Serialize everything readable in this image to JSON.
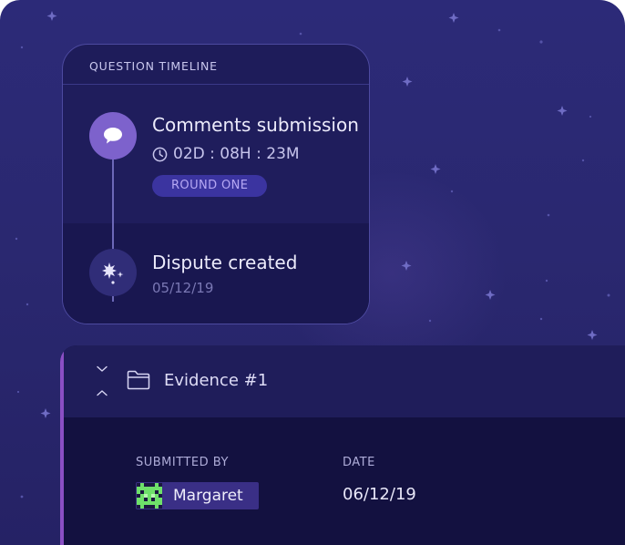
{
  "timeline": {
    "header": "QUESTION TIMELINE",
    "events": [
      {
        "title": "Comments submission",
        "icon": "speech-bubble-icon",
        "countdown": {
          "days": "02",
          "days_unit": "D",
          "hours": "08",
          "hours_unit": "H",
          "minutes": "23",
          "minutes_unit": "M",
          "separator": ":"
        },
        "badge": "ROUND ONE"
      },
      {
        "title": "Dispute created",
        "icon": "sparkle-icon",
        "date": "05/12/19"
      }
    ]
  },
  "evidence": {
    "title": "Evidence #1",
    "submitted_by_label": "SUBMITTED BY",
    "submitted_by_name": "Margaret",
    "date_label": "DATE",
    "date_value": "06/12/19"
  },
  "colors": {
    "background": "#2a2870",
    "card": "#1e1c5a",
    "accent_purple": "#7d62cc",
    "badge_bg": "#3b34a0",
    "badge_text": "#b6a8f4",
    "evidence_accent": "#8a4fc4",
    "avatar_green": "#6ee06a"
  }
}
